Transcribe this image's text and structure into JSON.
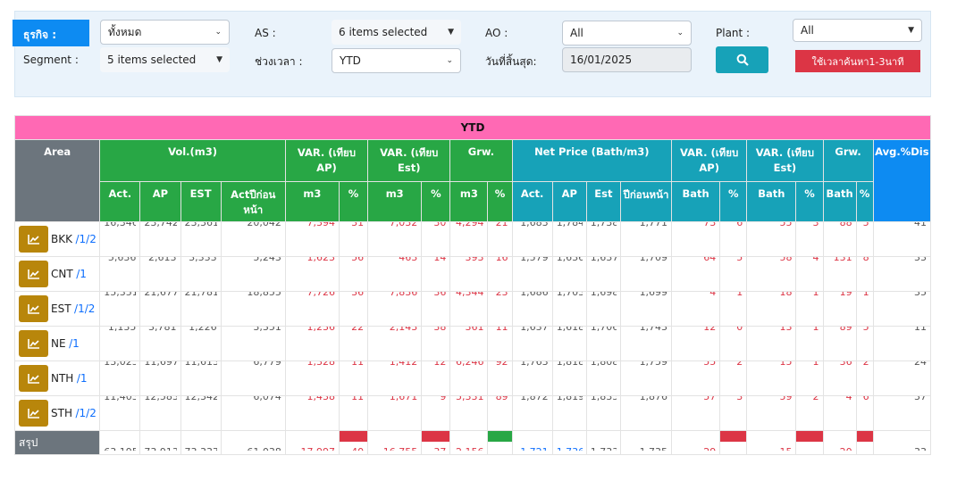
{
  "filters": {
    "business_label": "ธุรกิจ :",
    "business_value": "ทั้งหมด",
    "as_label": "AS :",
    "as_value": "6 items selected",
    "ao_label": "AO :",
    "ao_value": "All",
    "plant_label": "Plant :",
    "plant_value": "All",
    "segment_label": "Segment :",
    "segment_value": "5 items selected",
    "period_label": "ช่วงเวลา :",
    "period_value": "YTD",
    "enddate_label": "วันที่สิ้นสุด:",
    "enddate_value": "16/01/2025",
    "search_icon": "search-icon",
    "search_note": "ใช้เวลาค้นหา1-3นาที"
  },
  "table": {
    "title": "YTD",
    "groups": {
      "area": "Area",
      "vol": "Vol.(m3)",
      "var_ap": "VAR. (เทียบ AP)",
      "var_est": "VAR. (เทียบ Est)",
      "grw": "Grw.",
      "net_price": "Net Price (Bath/m3)",
      "var_ap2": "VAR. (เทียบ AP)",
      "var_est2": "VAR. (เทียบ Est)",
      "grw2": "Grw.",
      "avg_dis": "Avg.%Dis"
    },
    "subheaders": [
      "Act.",
      "AP",
      "EST",
      "Actปีก่อนหน้า",
      "m3",
      "%",
      "m3",
      "%",
      "m3",
      "%",
      "Act.",
      "AP",
      "Est",
      "ปีก่อนหน้า",
      "Bath",
      "%",
      "Bath",
      "%",
      "Bath",
      "%"
    ],
    "rows": [
      {
        "name": "BKK",
        "link": "/1/2",
        "cells": [
          "16,346",
          "23,742",
          "23,361",
          "20,042",
          "7,394",
          "31",
          "7,032",
          "30",
          "4,294",
          "21",
          "1,683",
          "1,784",
          "1,738",
          "1,771",
          "73",
          "6",
          "55",
          "3",
          "88",
          "5",
          "41"
        ]
      },
      {
        "name": "CNT",
        "link": "/1",
        "cells": [
          "5,636",
          "2,613",
          "3,333",
          "5,243",
          "1,623",
          "56",
          "463",
          "14",
          "393",
          "16",
          "1,579",
          "1,636",
          "1,637",
          "1,709",
          "64",
          "5",
          "58",
          "4",
          "131",
          "8",
          "33"
        ]
      },
      {
        "name": "EST",
        "link": "/1/2",
        "cells": [
          "15,351",
          "21,677",
          "21,781",
          "18,855",
          "7,726",
          "36",
          "7,836",
          "36",
          "4,344",
          "23",
          "1,686",
          "1,703",
          "1,698",
          "1,699",
          "4",
          "1",
          "18",
          "1",
          "19",
          "1",
          "35"
        ]
      },
      {
        "name": "NE",
        "link": "/1",
        "cells": [
          "1,135",
          "3,781",
          "1,226",
          "3,351",
          "1,236",
          "22",
          "2,143",
          "38",
          "361",
          "11",
          "1,637",
          "1,618",
          "1,706",
          "1,743",
          "12",
          "0",
          "13",
          "1",
          "89",
          "5",
          "11"
        ]
      },
      {
        "name": "NTH",
        "link": "/1",
        "cells": [
          "13,025",
          "11,697",
          "11,613",
          "6,779",
          "1,328",
          "11",
          "1,412",
          "12",
          "6,246",
          "92",
          "1,763",
          "1,818",
          "1,808",
          "1,759",
          "55",
          "2",
          "15",
          "1",
          "36",
          "2",
          "24"
        ]
      },
      {
        "name": "STH",
        "link": "/1/2",
        "cells": [
          "11,403",
          "12,583",
          "12,342",
          "6,074",
          "1,438",
          "11",
          "1,671",
          "9",
          "5,331",
          "89",
          "1,872",
          "1,819",
          "1,835",
          "1,876",
          "57",
          "3",
          "59",
          "2",
          "4",
          "6",
          "37"
        ]
      }
    ],
    "summary_label": "สรุป",
    "summary_cells": [
      "63,195",
      "73,913",
      "73,337",
      "61,038",
      "17,997",
      "40",
      "16,755",
      "37",
      "2,156",
      "",
      "1,721",
      "1,736",
      "1,733",
      "1,735",
      "29",
      "",
      "15",
      "",
      "20",
      "",
      "33"
    ]
  },
  "colors": {
    "pink": "#ff69b4",
    "green": "#28a745",
    "teal": "#17a2b8",
    "blue": "#0d8bf2",
    "gray": "#6c757d",
    "red": "#dc3545",
    "gold": "#b8860b"
  }
}
